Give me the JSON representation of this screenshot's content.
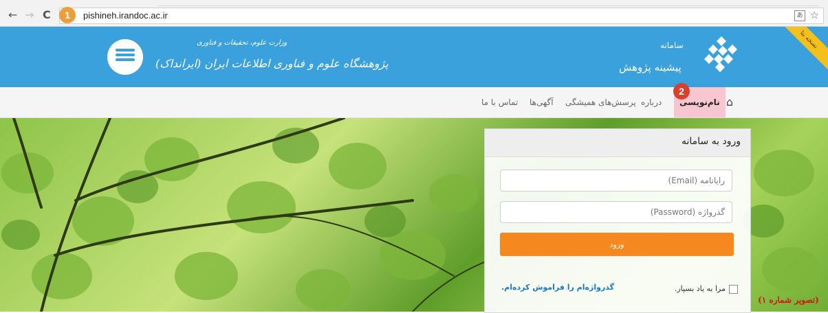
{
  "browser": {
    "url": "pishineh.irandoc.ac.ir",
    "back_icon": "←",
    "forward_icon": "→",
    "reload_icon": "C",
    "star_icon": "☆",
    "translate_icon": "あ"
  },
  "markers": {
    "m1": "1",
    "m2": "2"
  },
  "banner": {
    "ribbon": "نسخه بتا",
    "brand_top": "سامانه",
    "brand_main": "پیشینه پژوهش",
    "inst_small": "وزارت علوم، تحقیقات و فناوری",
    "inst_main": "پژوهشگاه علوم و فناوری اطلاعات ایران (ایرانداک)"
  },
  "menu": {
    "home_icon": "⌂",
    "items": [
      {
        "label": "نام‌نویسی"
      },
      {
        "label": "درباره"
      },
      {
        "label": "پرسش‌های همیشگی"
      },
      {
        "label": "آگهی‌ها"
      },
      {
        "label": "تماس با ما"
      }
    ]
  },
  "login": {
    "title": "ورود به سامانه",
    "email_placeholder": "رایانامه (Email)",
    "password_placeholder": "گذرواژه (Password)",
    "submit": "ورود",
    "remember": "مرا به یاد بسپار.",
    "forgot": "گذرواژه‌ام را فراموش کرده‌ام."
  },
  "caption": "(تصویر شماره ۱)",
  "colors": {
    "banner": "#3aa1dc",
    "submit": "#f5891f",
    "active_menu": "#f7c6d0",
    "caption": "#d41616"
  }
}
